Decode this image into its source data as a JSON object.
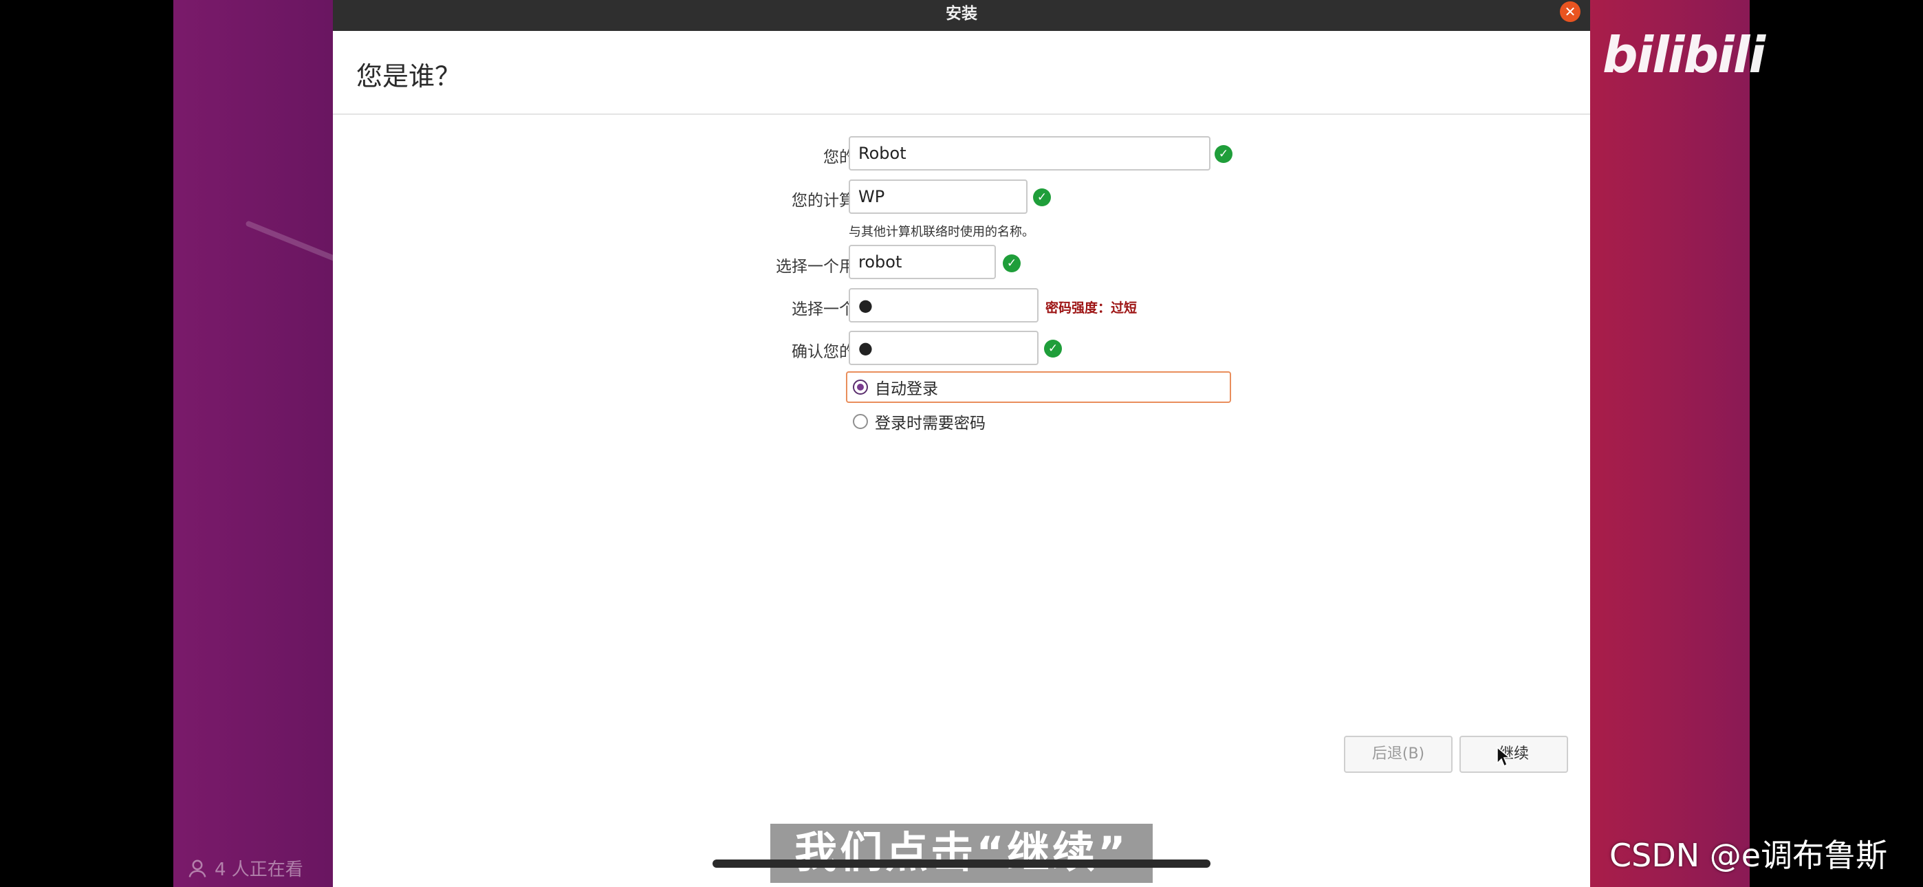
{
  "window": {
    "title": "安装",
    "close_icon": "close-icon"
  },
  "page": {
    "title": "您是谁？"
  },
  "form": {
    "name": {
      "label": "您的姓名：",
      "value": "Robot"
    },
    "computer": {
      "label": "您的计算机名：",
      "value": "WP",
      "hint": "与其他计算机联络时使用的名称。"
    },
    "username": {
      "label": "选择一个用户名：",
      "value": "robot"
    },
    "password": {
      "label": "选择一个密码：",
      "value": "●",
      "strength": "密码强度：过短"
    },
    "confirm": {
      "label": "确认您的密码：",
      "value": "●"
    },
    "login_options": [
      {
        "label": "自动登录",
        "selected": true
      },
      {
        "label": "登录时需要密码",
        "selected": false
      }
    ]
  },
  "buttons": {
    "back": "后退(B)",
    "continue": "继续"
  },
  "overlay": {
    "viewers": "4 人正在看",
    "subtitle": "我们点击“继续”",
    "watermark_csdn": "CSDN @e调布鲁斯",
    "brand_logo": "bilibili"
  },
  "colors": {
    "accent": "#e95420",
    "ok": "#1f9e3a",
    "strength_warn": "#9d1414",
    "radio": "#7a3b8f"
  }
}
